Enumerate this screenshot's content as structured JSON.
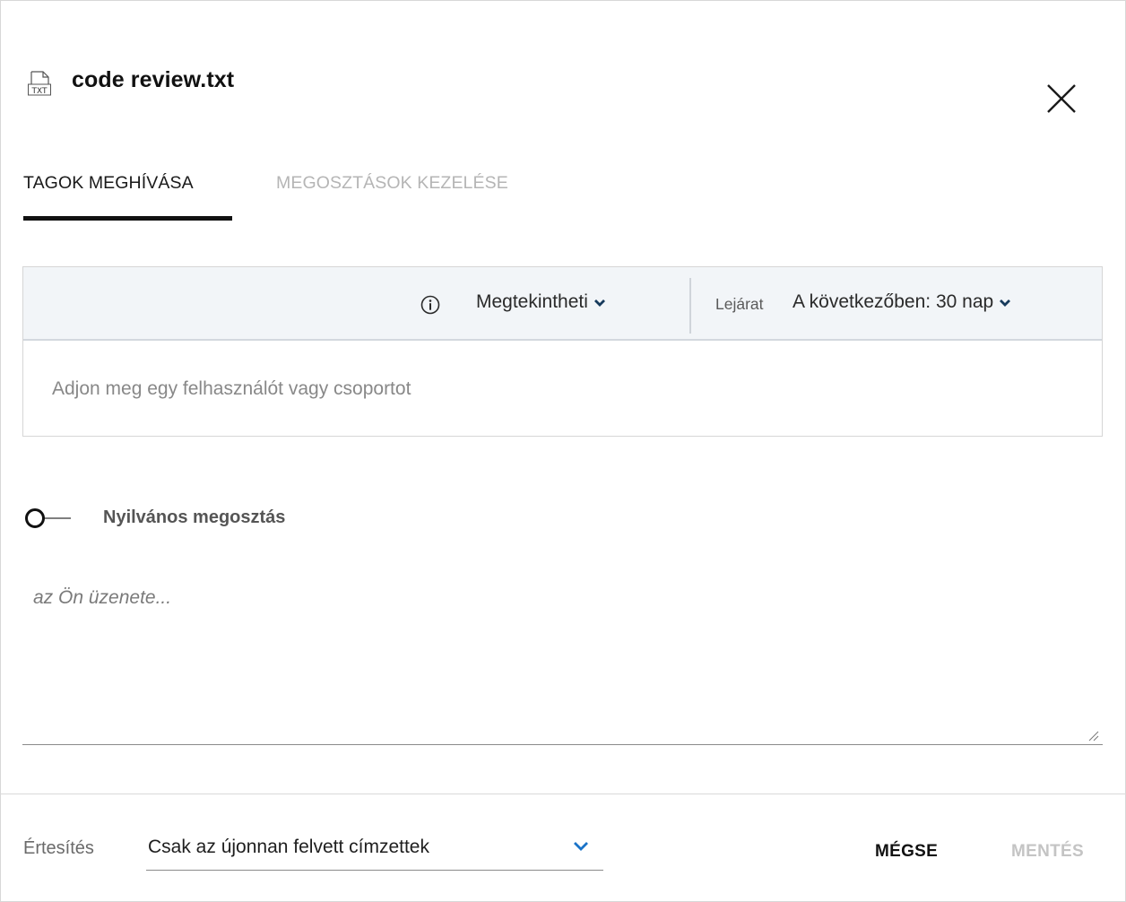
{
  "header": {
    "file_icon": "txt-file-icon",
    "file_icon_text": "TXT",
    "title": "code review.txt",
    "close_icon": "close-icon"
  },
  "tabs": [
    {
      "label": "TAGOK MEGHÍVÁSA",
      "active": true
    },
    {
      "label": "MEGOSZTÁSOK KEZELÉSE",
      "active": false
    }
  ],
  "share": {
    "info_icon": "info-icon",
    "permission": "Megtekintheti",
    "expiry_label": "Lejárat",
    "expiry_value": "A következőben: 30 nap",
    "user_placeholder": "Adjon meg egy felhasználót vagy csoportot"
  },
  "public_share": {
    "label": "Nyilvános megosztás",
    "enabled": false
  },
  "message": {
    "placeholder": "az Ön üzenete..."
  },
  "footer": {
    "notify_label": "Értesítés",
    "notify_value": "Csak az újonnan felvett címzettek",
    "cancel_label": "MÉGSE",
    "save_label": "MENTÉS"
  },
  "colors": {
    "accent_chevron": "#1a73c8",
    "dark_chevron": "#163a5c",
    "toolbar_bg": "#f2f5f8",
    "disabled_text": "#c4c4c4"
  }
}
